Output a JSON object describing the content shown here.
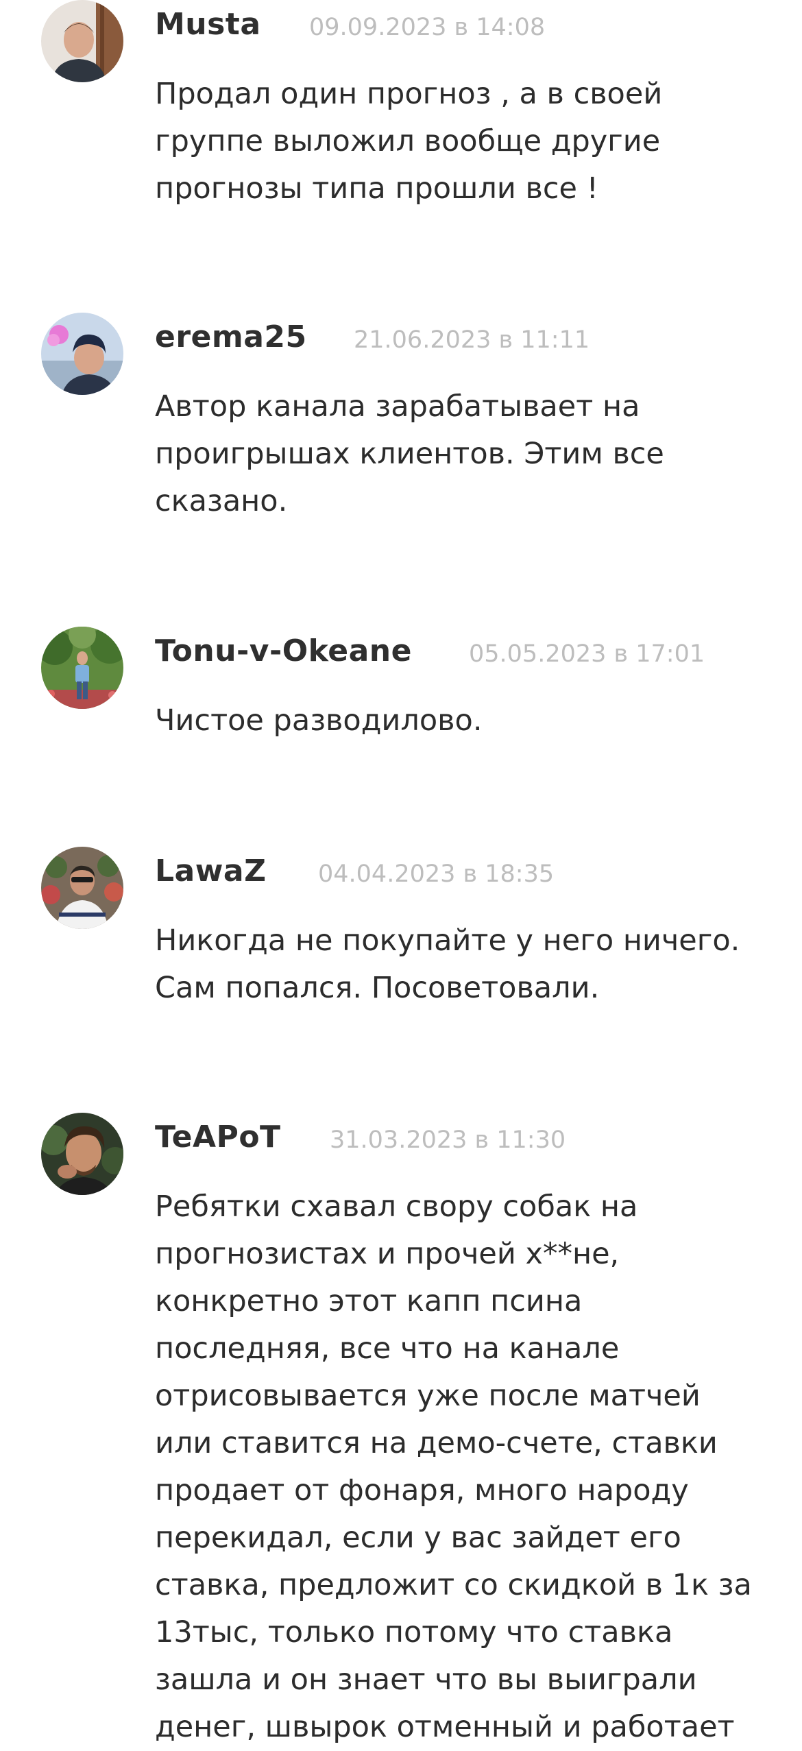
{
  "comments": [
    {
      "author": "Musta",
      "date": "09.09.2023 в 14:08",
      "text": "Продал один прогноз , а в своей группе выложил вообще другие прогнозы типа прошли все !",
      "avatar_icon": "user-photo-icon"
    },
    {
      "author": "erema25",
      "date": "21.06.2023 в 11:11",
      "text": "Автор канала зарабатывает на проигрышах клиентов. Этим все сказано.",
      "avatar_icon": "user-photo-icon"
    },
    {
      "author": "Tonu-v-Okeane",
      "date": "05.05.2023 в 17:01",
      "text": "Чистое разводилово.",
      "avatar_icon": "user-photo-icon"
    },
    {
      "author": "LawaZ",
      "date": "04.04.2023 в 18:35",
      "text": "Никогда не покупайте у него ничего. Сам попался. Посоветовали.",
      "avatar_icon": "user-photo-icon"
    },
    {
      "author": "TeAPoT",
      "date": "31.03.2023 в 11:30",
      "text": "Ребятки схавал свору собак на прогнозистах и прочей х**не, конкретно этот капп псина последняя, все что на канале отрисовывается уже после матчей или ставится на демо-счете, ставки продает от фонаря, много народу перекидал, если у вас зайдет его ставка, предложит со скидкой в 1к за 13тыс, только потому что ставка зашла и он знает что вы выиграли денег, швырок отменный и работает",
      "avatar_icon": "user-photo-icon"
    }
  ],
  "colors": {
    "author": "#2f2f2f",
    "date": "#bdbdbd",
    "text": "#2c2c2c",
    "background": "#ffffff"
  }
}
